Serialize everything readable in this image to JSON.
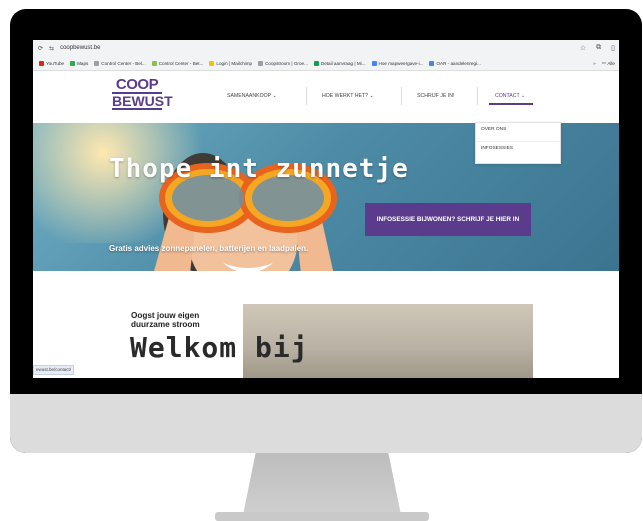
{
  "browser": {
    "url": "coopbewust.be",
    "bookmarks": [
      {
        "label": "YouTube",
        "color": "#e62117"
      },
      {
        "label": "Maps",
        "color": "#34a853"
      },
      {
        "label": "Control Center - Bel...",
        "color": "#9aa0a6"
      },
      {
        "label": "Control Center - Bet...",
        "color": "#8bc34a"
      },
      {
        "label": "Login | Mailchimp",
        "color": "#f4c20d"
      },
      {
        "label": "Coopstroom | Groe...",
        "color": "#9aa0a6"
      },
      {
        "label": "Detail aanvraag | Mi...",
        "color": "#0f9d58"
      },
      {
        "label": "Hoe mapweergave-i...",
        "color": "#4285f4"
      },
      {
        "label": "OAR - aandelenregi...",
        "color": "#4285f4"
      }
    ],
    "more_bookmarks": "»",
    "all_bookmarks": "Alle"
  },
  "site": {
    "logo_top": "COOP",
    "logo_bottom": "BEWUST",
    "menu": {
      "samenaankoop": "SAMENAANKOOP ⌄",
      "hoe_werkt_het": "HOE WERKT HET? ⌄",
      "schrijf_je_in": "SCHRIJF JE IN!",
      "contact": "CONTACT ⌄"
    },
    "dropdown": {
      "over_ons": "OVER ONS",
      "infosessies": "INFOSESSIES"
    }
  },
  "hero": {
    "title": "Thope int zunnetje",
    "cta": "INFOSESSIE BIJWONEN? SCHRIJF JE HIER IN",
    "subtitle": "Gratis advies zonnepanelen, batterijen en laadpalen."
  },
  "content": {
    "intro_line1": "Oogst jouw eigen",
    "intro_line2": "duurzame stroom",
    "welcome": "Welkom bij"
  },
  "status_bar": {
    "link": "ewust.be/contact/"
  },
  "colors": {
    "brand": "#5a3d8a",
    "cta": "#5b3c8c"
  }
}
